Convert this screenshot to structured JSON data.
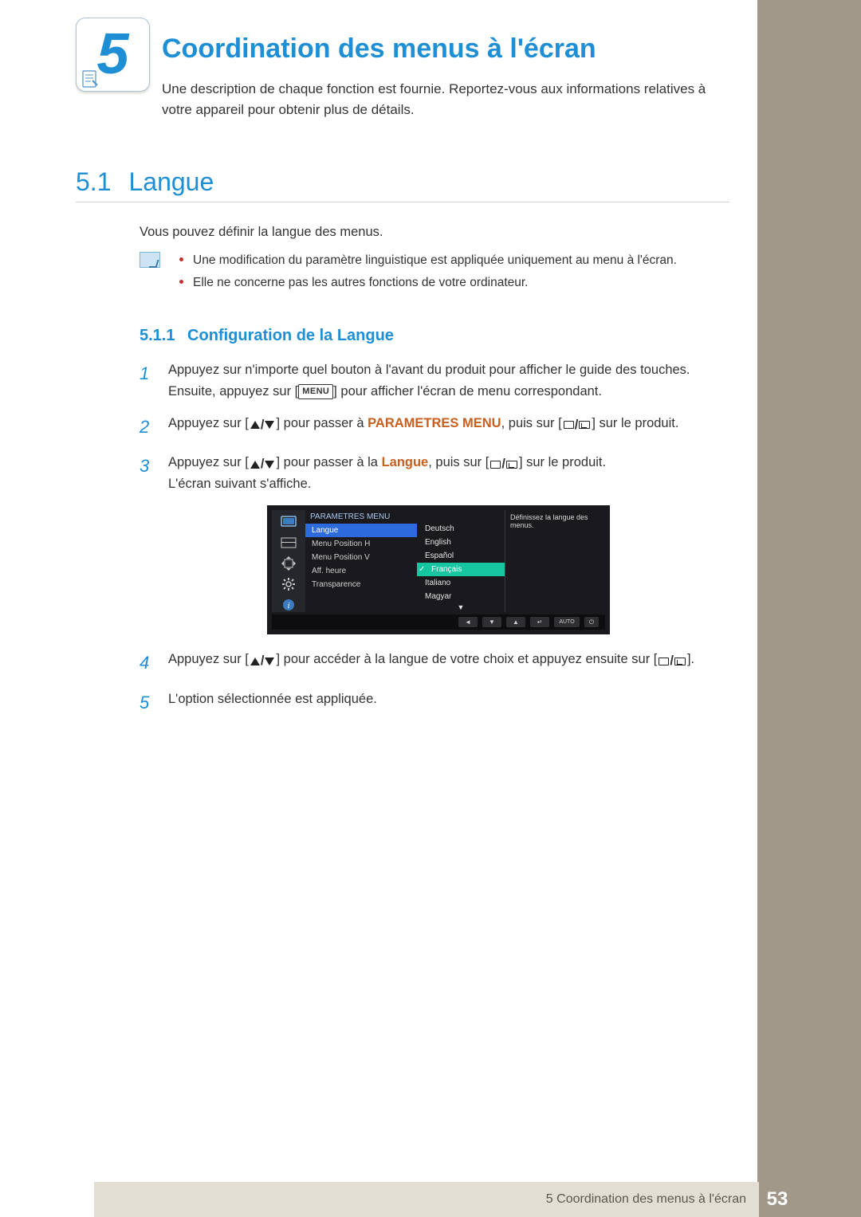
{
  "chapter": {
    "number": "5",
    "title": "Coordination des menus à l'écran",
    "intro": "Une description de chaque fonction est fournie. Reportez-vous aux informations relatives à votre appareil pour obtenir plus de détails."
  },
  "section": {
    "number": "5.1",
    "title": "Langue",
    "intro": "Vous pouvez définir la langue des menus.",
    "notes": [
      "Une modification du paramètre linguistique est appliquée uniquement au menu à l'écran.",
      "Elle ne concerne pas les autres fonctions de votre ordinateur."
    ]
  },
  "subsection": {
    "number": "5.1.1",
    "title": "Configuration de la Langue"
  },
  "steps": {
    "s1a": "Appuyez sur n'importe quel bouton à l'avant du produit pour afficher le guide des touches. Ensuite, appuyez sur [",
    "s1b": "] pour afficher l'écran de menu correspondant.",
    "menu_tag": "MENU",
    "s2a": "Appuyez sur [",
    "s2b": "] pour passer à ",
    "s2_kw": "PARAMETRES MENU",
    "s2c": ", puis sur [",
    "s2d": "] sur le produit.",
    "s3a": "Appuyez sur [",
    "s3b": "] pour passer à la ",
    "s3_kw": "Langue",
    "s3c": ", puis sur [",
    "s3d": "] sur le produit.",
    "s3e": "L'écran suivant s'affiche.",
    "s4a": "Appuyez sur [",
    "s4b": "] pour accéder à la langue de votre choix et appuyez ensuite sur [",
    "s4c": "].",
    "s5": "L'option sélectionnée est appliquée."
  },
  "osd": {
    "header": "PARAMETRES MENU",
    "left_items": [
      "Langue",
      "Menu Position H",
      "Menu Position V",
      "Aff. heure",
      "Transparence"
    ],
    "right_items": [
      "Deutsch",
      "English",
      "Español",
      "Français",
      "Italiano",
      "Magyar"
    ],
    "selected_index": 3,
    "tip": "Définissez la langue des menus.",
    "bar_auto": "AUTO"
  },
  "footer": {
    "text": "5 Coordination des menus à l'écran",
    "page": "53"
  }
}
